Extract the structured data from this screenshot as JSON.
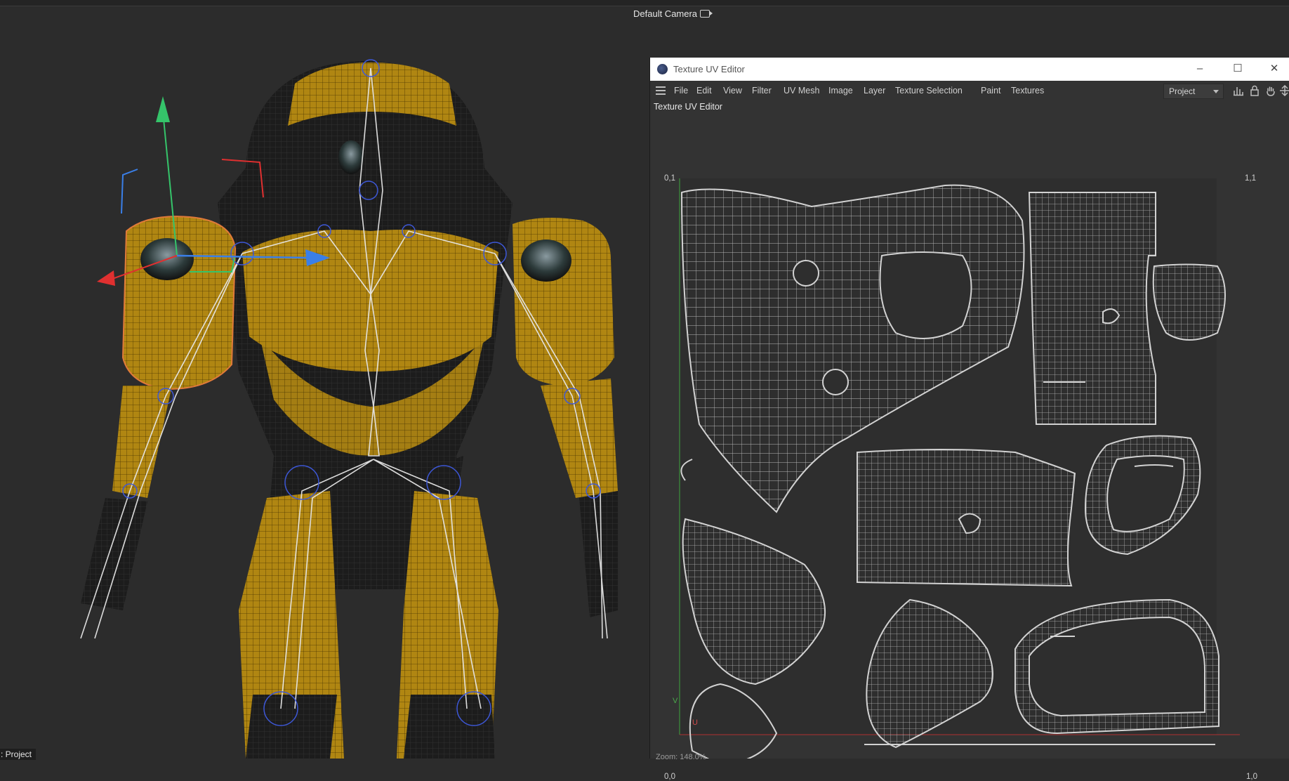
{
  "viewport": {
    "camera_label": "Default Camera",
    "camera_icon": "camera-icon",
    "status_label": ": Project"
  },
  "uv_editor": {
    "window_title": "Texture UV Editor",
    "app_icon": "cinema4d-logo-icon",
    "window_controls": {
      "minimize": "–",
      "maximize": "☐",
      "close": "✕"
    },
    "menu": [
      "File",
      "Edit",
      "View",
      "Filter",
      "UV Mesh",
      "Image",
      "Layer",
      "Texture Selection",
      "Paint",
      "Textures"
    ],
    "project_dropdown": "Project",
    "toolbar_icons": [
      "histogram-icon",
      "lock-icon",
      "hand-icon",
      "move-down-icon"
    ],
    "panel_title": "Texture UV Editor",
    "corners": {
      "top_left": "0,1",
      "top_right": "1,1",
      "bottom_left": "0,0",
      "bottom_right": "1,0"
    },
    "axis_v": "V",
    "axis_u": "U",
    "zoom": "Zoom: 148.0%"
  },
  "colors": {
    "background": "#2c2c2c",
    "armor_yellow": "#b58c14",
    "armor_dark": "#1e1e1e",
    "bone_color": "#e6e6e6",
    "joint_color": "#3d57d6",
    "axis_x": "#e03030",
    "axis_y": "#35c46a",
    "axis_z": "#3a7fe8",
    "selection": "#e07a3a",
    "uv_wire": "#c8c8c8"
  }
}
